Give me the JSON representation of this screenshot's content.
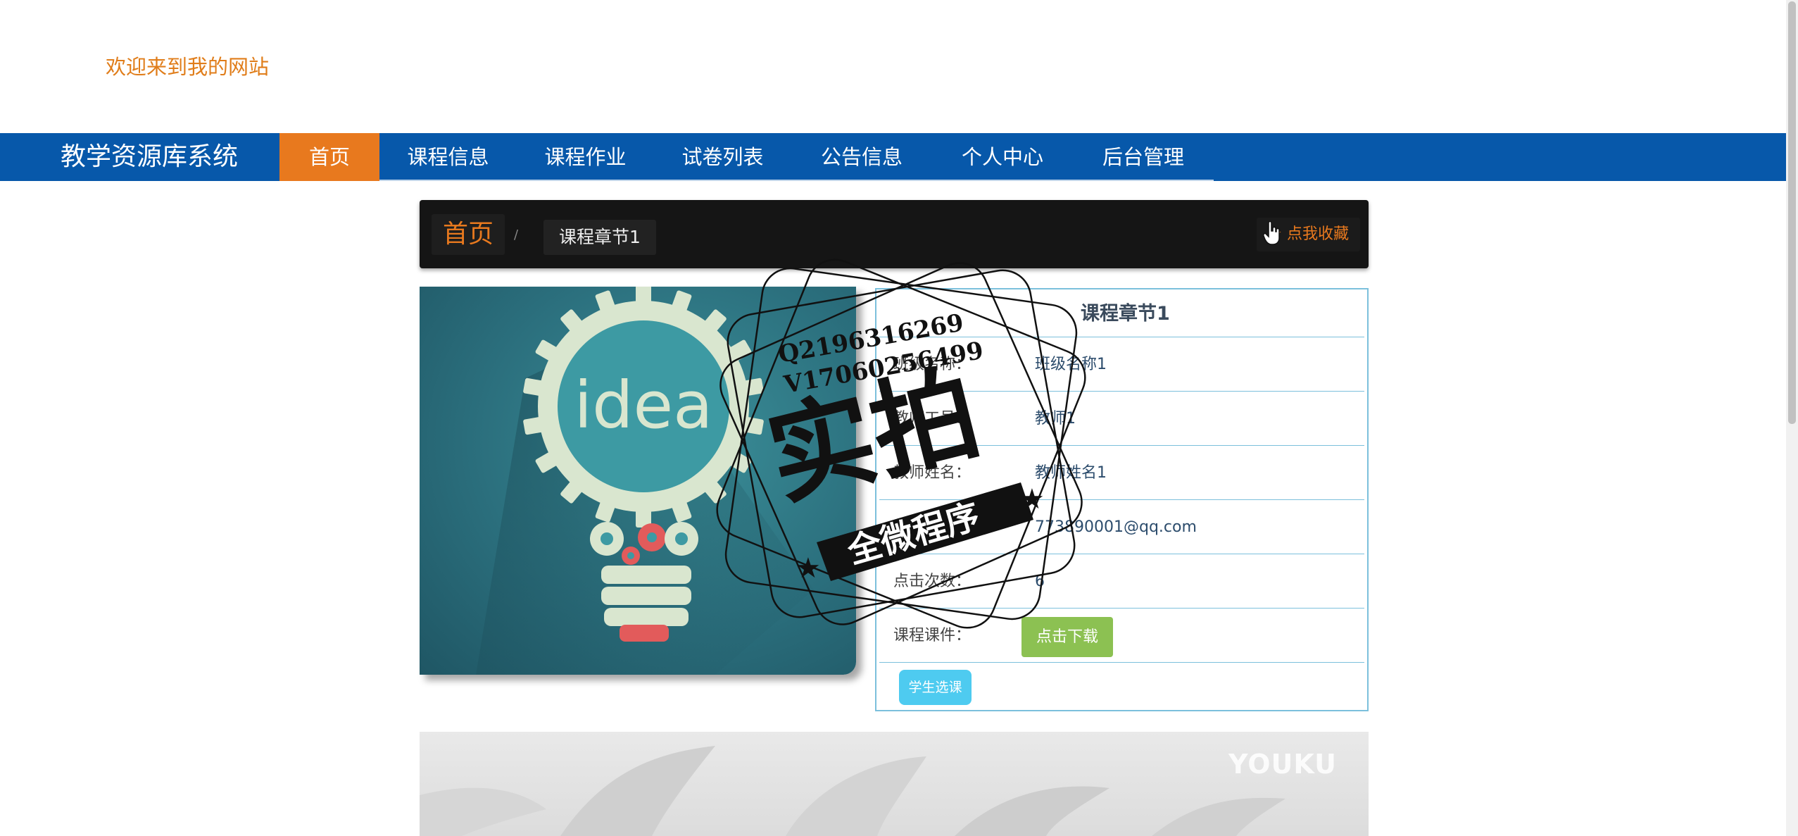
{
  "header": {
    "welcome": "欢迎来到我的网站"
  },
  "nav": {
    "brand": "教学资源库系统",
    "items": [
      {
        "label": "首页",
        "active": true
      },
      {
        "label": "课程信息"
      },
      {
        "label": "课程作业"
      },
      {
        "label": "试卷列表"
      },
      {
        "label": "公告信息"
      },
      {
        "label": "个人中心"
      },
      {
        "label": "后台管理"
      }
    ]
  },
  "breadcrumb": {
    "home": "首页",
    "separator": "/",
    "current": "课程章节1",
    "favorite": "☆ 点我收藏"
  },
  "image": {
    "word": "idea"
  },
  "detail": {
    "title": "课程章节1",
    "rows": [
      {
        "label": "班级名称：",
        "value": "班级名称1"
      },
      {
        "label": "教师工号：",
        "value": "教师1"
      },
      {
        "label": "教师姓名：",
        "value": "教师姓名1"
      },
      {
        "label": "邮箱：",
        "value": "773890001@qq.com"
      },
      {
        "label": "点击次数：",
        "value": "6"
      }
    ],
    "courseware_label": "课程课件：",
    "download_button": "点击下载",
    "select_button": "学生选课"
  },
  "watermark": {
    "line1": "Q2196316269",
    "line2": "V17060256499",
    "big": "实拍",
    "banner": "全微程序"
  },
  "video": {
    "logo": "YOUKU"
  },
  "colors": {
    "nav": "#0758aa",
    "accent": "#e8791e",
    "download": "#8cc152",
    "select": "#4ecbf0"
  }
}
